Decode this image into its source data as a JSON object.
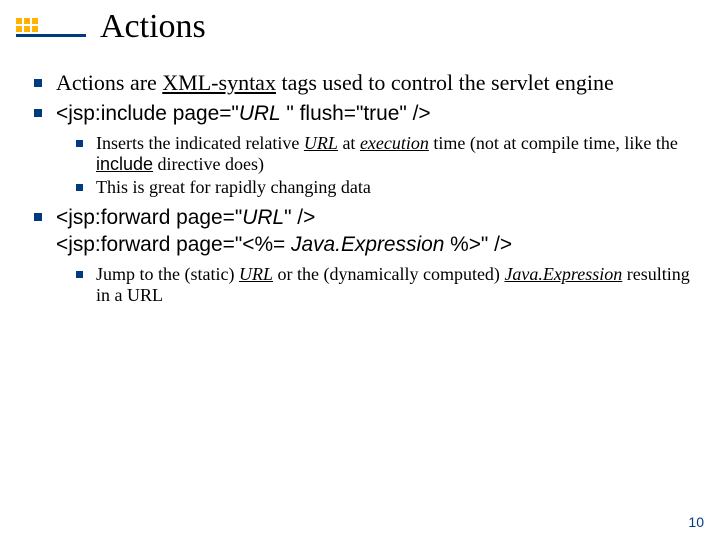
{
  "slide": {
    "title": "Actions",
    "number": "10",
    "bullets": {
      "b1_pre": "Actions are ",
      "b1_u": "XML-syntax",
      "b1_post": " tags used to control the servlet engine",
      "b2_pre": "<jsp:include page=\"",
      "b2_url": "URL",
      "b2_post": " \" flush=\"true\" />",
      "b2_sub1_a": "Inserts the indicated relative ",
      "b2_sub1_url": "URL",
      "b2_sub1_b": " at ",
      "b2_sub1_exec": "execution",
      "b2_sub1_c": " time (not at compile time, like the ",
      "b2_sub1_inc": "include",
      "b2_sub1_d": " directive does)",
      "b2_sub2": "This is great for rapidly changing data",
      "b3_l1_pre": "<jsp:forward page=\"",
      "b3_l1_url": "URL",
      "b3_l1_post": "\" />",
      "b3_l2_pre": "<jsp:forward page=\"<%= ",
      "b3_l2_expr": "Java.Expression",
      "b3_l2_post": " %>\" />",
      "b3_sub1_a": "Jump to the (static) ",
      "b3_sub1_url": "URL",
      "b3_sub1_b": " or the (dynamically computed) ",
      "b3_sub1_expr": "Java.Expression",
      "b3_sub1_c": " resulting in a URL"
    }
  }
}
